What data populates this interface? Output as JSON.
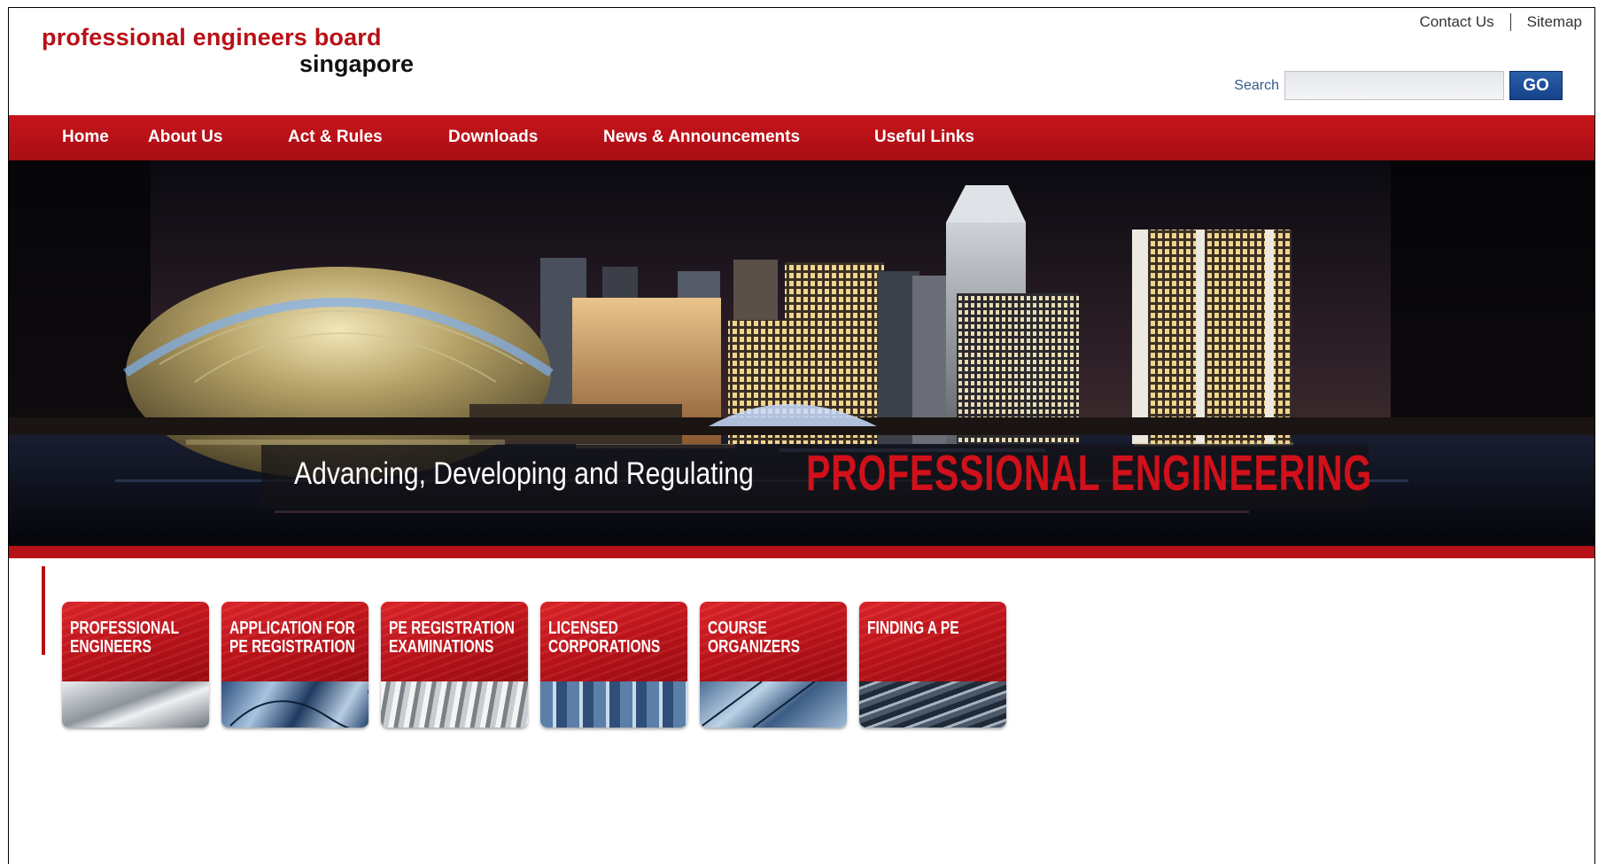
{
  "header": {
    "logo_line1": "professional engineers board",
    "logo_line2": "singapore",
    "util_links": [
      "Contact Us",
      "Sitemap"
    ],
    "search_label": "Search",
    "search_value": "",
    "search_button": "GO"
  },
  "nav": {
    "items": [
      "Home",
      "About Us",
      "Act & Rules",
      "Downloads",
      "News & Announcements",
      "Useful Links"
    ]
  },
  "hero": {
    "tagline": "Advancing, Developing and Regulating",
    "tagline_emphasis": "PROFESSIONAL ENGINEERING"
  },
  "tiles": [
    {
      "label": "PROFESSIONAL\nENGINEERS"
    },
    {
      "label": "APPLICATION FOR\nPE REGISTRATION"
    },
    {
      "label": "PE REGISTRATION\nEXAMINATIONS"
    },
    {
      "label": "LICENSED\nCORPORATIONS"
    },
    {
      "label": "COURSE\nORGANIZERS"
    },
    {
      "label": "FINDING A PE"
    }
  ],
  "colors": {
    "brand_red": "#b81016",
    "go_button_blue": "#1f4f96",
    "search_label_blue": "#355a8c"
  }
}
